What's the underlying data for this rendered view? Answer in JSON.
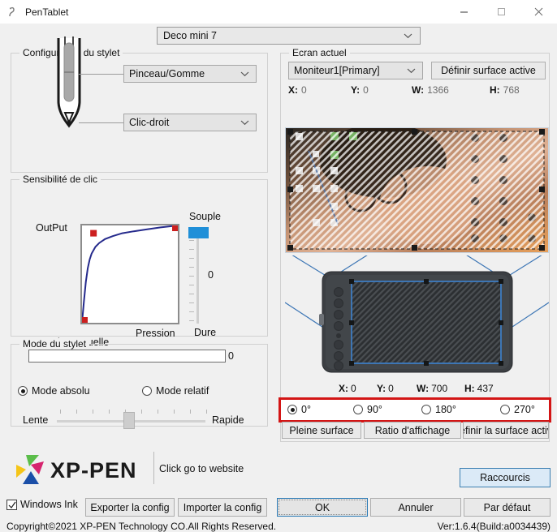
{
  "window": {
    "title": "PenTablet",
    "icon": "pentablet-app-icon",
    "controls": {
      "minimize": "minimize-icon",
      "maximize": "maximize-icon",
      "close": "close-icon"
    }
  },
  "device_selector": {
    "value": "Deco mini 7",
    "chevron": "chevron-down-icon"
  },
  "pen_config": {
    "title": "Configuration du stylet",
    "illustration": "stylus-pen-illustration",
    "upper_button": {
      "value": "Pinceau/Gomme",
      "chevron": "chevron-down-icon"
    },
    "lower_button": {
      "value": "Clic-droit",
      "chevron": "chevron-down-icon"
    }
  },
  "sensitivity": {
    "title": "Sensibilité de clic",
    "output_label": "OutPut",
    "pressure_label": "Pression",
    "slider_top_label": "Souple",
    "slider_bottom_label": "Dure",
    "slider_value": "0",
    "current_pressure_label": "Pression actuelle",
    "current_pressure_value": "0"
  },
  "chart_data": {
    "type": "line",
    "title": "Sensibilité de clic",
    "xlabel": "Pression",
    "ylabel": "OutPut",
    "xlim": [
      0,
      100
    ],
    "ylim": [
      0,
      100
    ],
    "grid": false,
    "legend": null,
    "series": [
      {
        "name": "pressure-response-curve",
        "x": [
          0,
          2,
          4,
          6,
          8,
          10,
          14,
          18,
          24,
          32,
          42,
          54,
          68,
          82,
          100
        ],
        "y": [
          0,
          22,
          42,
          56,
          65,
          71,
          78,
          82,
          86,
          89,
          92,
          94,
          96,
          98,
          100
        ]
      }
    ],
    "control_points": [
      {
        "name": "start-handle",
        "x": 0,
        "y": 0
      },
      {
        "name": "mid-handle",
        "x": 12,
        "y": 92
      },
      {
        "name": "end-handle",
        "x": 100,
        "y": 100
      }
    ]
  },
  "pen_mode": {
    "title": "Mode du stylet",
    "absolute": {
      "label": "Mode absolu",
      "selected": true
    },
    "relative": {
      "label": "Mode relatif",
      "selected": false
    },
    "speed_min_label": "Lente",
    "speed_max_label": "Rapide",
    "speed_value": 45
  },
  "screen": {
    "title": "Ecran actuel",
    "monitor": {
      "value": "Moniteur1[Primary]",
      "chevron": "chevron-down-icon"
    },
    "set_active_area_button": "Définir surface active",
    "monitor_metrics": [
      {
        "key": "X:",
        "value": "0"
      },
      {
        "key": "Y:",
        "value": "0"
      },
      {
        "key": "W:",
        "value": "1366"
      },
      {
        "key": "H:",
        "value": "768"
      }
    ],
    "tablet_metrics": [
      {
        "key": "X:",
        "value": "0"
      },
      {
        "key": "Y:",
        "value": "0"
      },
      {
        "key": "W:",
        "value": "700"
      },
      {
        "key": "H:",
        "value": "437"
      }
    ],
    "rotation": [
      {
        "label": "0°",
        "selected": true
      },
      {
        "label": "90°",
        "selected": false
      },
      {
        "label": "180°",
        "selected": false
      },
      {
        "label": "270°",
        "selected": false
      }
    ],
    "buttons": {
      "full_area": "Pleine surface",
      "display_ratio": "Ratio d'affichage",
      "set_active_area": "éfinir la surface activ"
    },
    "highlight_color": "#d31515"
  },
  "footer": {
    "brand": "XP-PEN",
    "brand_caption": "Click go to website",
    "shortcuts_button": "Raccourcis",
    "windows_ink": {
      "label": "Windows Ink",
      "checked": true
    },
    "export_button": "Exporter la config",
    "import_button": "Importer la config",
    "ok_button": "OK",
    "cancel_button": "Annuler",
    "default_button": "Par défaut",
    "copyright": "Copyright©2021  XP-PEN Technology CO.All Rights Reserved.",
    "version": "Ver:1.6.4(Build:a0034439)"
  }
}
